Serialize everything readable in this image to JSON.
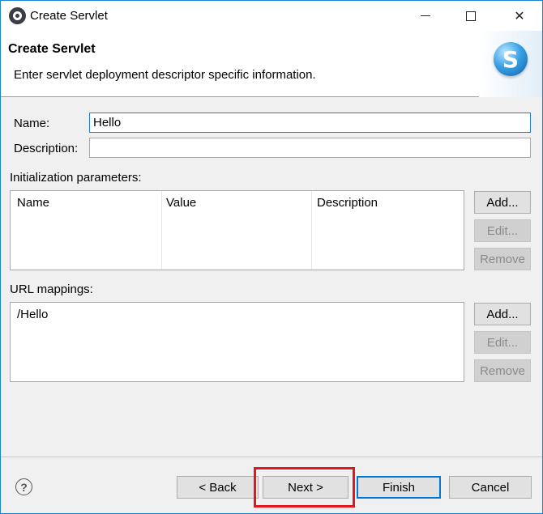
{
  "window": {
    "title": "Create Servlet",
    "controls": {
      "minimize": "minimize",
      "maximize": "maximize",
      "close": "✕"
    }
  },
  "banner": {
    "title": "Create Servlet",
    "description": "Enter servlet deployment descriptor specific information.",
    "logo_letter": "S"
  },
  "form": {
    "name_label": "Name:",
    "name_value": "Hello",
    "description_label": "Description:",
    "description_value": ""
  },
  "init_params": {
    "label": "Initialization parameters:",
    "columns": [
      "Name",
      "Value",
      "Description"
    ],
    "rows": [],
    "buttons": {
      "add": "Add...",
      "edit": "Edit...",
      "remove": "Remove"
    }
  },
  "url_mappings": {
    "label": "URL mappings:",
    "items": [
      "/Hello"
    ],
    "buttons": {
      "add": "Add...",
      "edit": "Edit...",
      "remove": "Remove"
    }
  },
  "footer": {
    "help": "?",
    "back": "< Back",
    "next": "Next >",
    "finish": "Finish",
    "cancel": "Cancel"
  },
  "colors": {
    "accent": "#0078d7",
    "highlight": "#e0171e"
  }
}
